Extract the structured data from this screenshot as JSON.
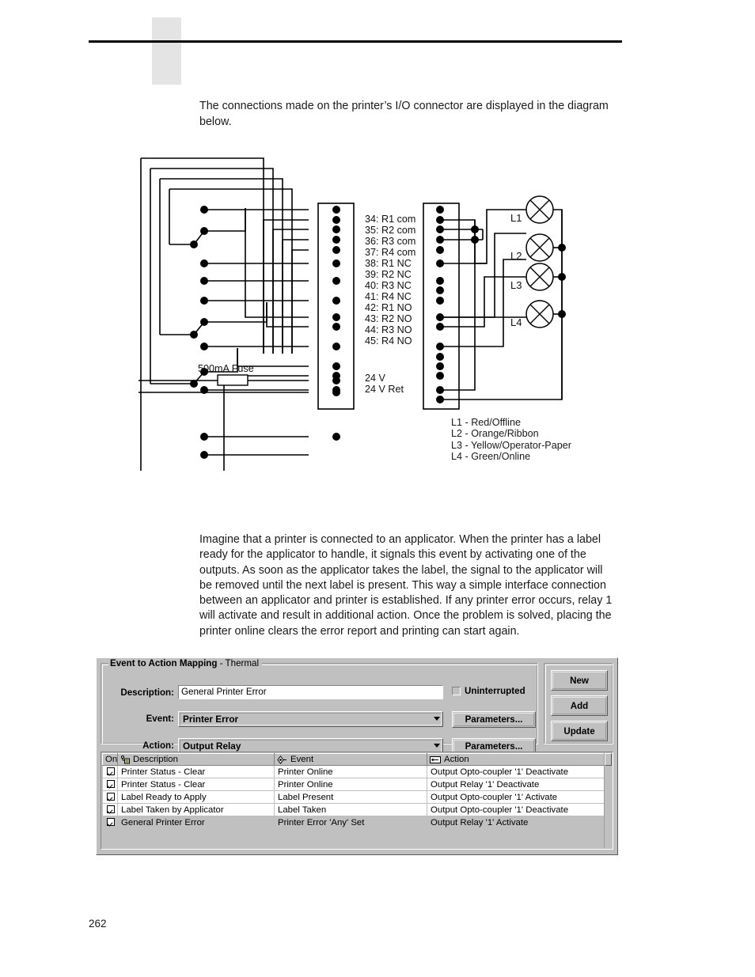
{
  "page": {
    "number": "262",
    "intro_paragraph": "The connections made on the printer’s I/O connector are displayed in the diagram below.",
    "body_paragraph": "Imagine that a printer is connected to an applicator. When the printer has a label ready for the applicator to handle, it signals this event by activating one of the outputs. As soon as the applicator takes the label, the signal to the applicator will be removed until the next label is present. This way a simple interface connection between an applicator and printer is established. If any printer error occurs, relay 1 will activate and result in additional action. Once the problem is solved, placing the printer online clears the error report and printing can start again."
  },
  "diagram": {
    "fuse_label": "500mA Fuse",
    "pin_labels": [
      "34: R1 com",
      "35: R2 com",
      "36: R3 com",
      "37: R4 com",
      "38: R1 NC",
      "39: R2 NC",
      "40: R3 NC",
      "41: R4 NC",
      "42: R1 NO",
      "43: R2 NO",
      "44: R3 NO",
      "45: R4 NO"
    ],
    "power_labels": [
      "24 V",
      "24 V Ret"
    ],
    "lamp_labels": [
      "L1",
      "L2",
      "L3",
      "L4"
    ],
    "legend": [
      "L1 - Red/Offline",
      "L2 - Orange/Ribbon",
      "L3 - Yellow/Operator-Paper",
      "L4 - Green/Online"
    ]
  },
  "dialog": {
    "group_title_bold": "Event to Action Mapping",
    "group_title_rest": " - Thermal",
    "fields": {
      "description_label": "Description:",
      "description_value": "General Printer Error",
      "event_label": "Event:",
      "event_value": "Printer Error",
      "action_label": "Action:",
      "action_value": "Output Relay"
    },
    "uninterrupted_label": "Uninterrupted",
    "uninterrupted_checked": false,
    "event_parameters_label": "Parameters...",
    "action_parameters_label": "Parameters...",
    "buttons": {
      "new": "New",
      "add": "Add",
      "update": "Update"
    },
    "table": {
      "columns": [
        "On",
        "Description",
        "Event",
        "Action"
      ],
      "rows": [
        {
          "on": true,
          "description": "Printer Status - Clear",
          "event": "Printer Online",
          "action": "Output Opto-coupler '1' Deactivate",
          "selected": false
        },
        {
          "on": true,
          "description": "Printer Status - Clear",
          "event": "Printer Online",
          "action": "Output Relay '1' Deactivate",
          "selected": false
        },
        {
          "on": true,
          "description": "Label Ready to Apply",
          "event": "Label Present",
          "action": "Output Opto-coupler '1' Activate",
          "selected": false
        },
        {
          "on": true,
          "description": "Label Taken by Applicator",
          "event": "Label Taken",
          "action": "Output Opto-coupler '1' Deactivate",
          "selected": false
        },
        {
          "on": true,
          "description": "General Printer Error",
          "event": "Printer Error 'Any' Set",
          "action": "Output Relay '1' Activate",
          "selected": true
        }
      ]
    }
  },
  "colors": {
    "dialog_face": "#c0c0c0",
    "header_bar": "#e4e4e4",
    "text": "#1a1a1a"
  }
}
